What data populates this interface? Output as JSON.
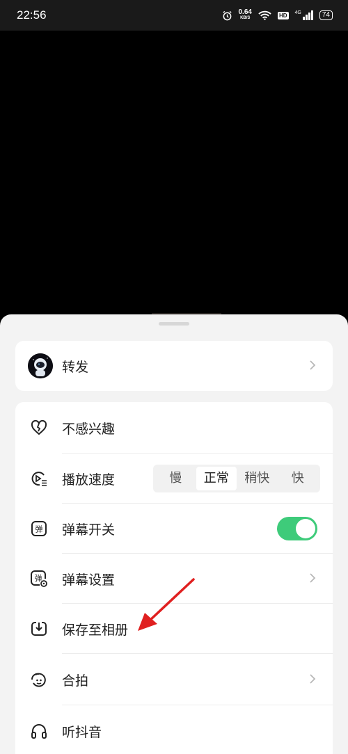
{
  "status_bar": {
    "time": "22:56",
    "net_speed_value": "0.64",
    "net_speed_unit": "KB/S",
    "hd_badge": "HD",
    "network_type": "4G",
    "battery": "74",
    "icons": [
      "alarm-icon",
      "wifi-icon",
      "hd-icon",
      "signal-icon",
      "battery-icon"
    ]
  },
  "sheet": {
    "forward": {
      "label": "转发",
      "icon": "astronaut-avatar"
    },
    "options": [
      {
        "label": "不感兴趣",
        "icon": "broken-heart-icon"
      },
      {
        "label": "播放速度",
        "icon": "play-speed-icon"
      },
      {
        "label": "弹幕开关",
        "icon": "danmaku-icon",
        "icon_text": "弹"
      },
      {
        "label": "弹幕设置",
        "icon": "danmaku-settings-icon",
        "icon_text": "弹"
      },
      {
        "label": "保存至相册",
        "icon": "download-icon"
      },
      {
        "label": "合拍",
        "icon": "duet-icon"
      },
      {
        "label": "听抖音",
        "icon": "headphones-icon"
      }
    ],
    "playback_speed": {
      "options": [
        "慢",
        "正常",
        "稍快",
        "快"
      ],
      "selected": "正常"
    },
    "danmaku_toggle_on": true
  },
  "colors": {
    "toggle_on": "#3ecb7a",
    "annotation_arrow": "#e02020",
    "sheet_bg": "#f3f3f3"
  }
}
